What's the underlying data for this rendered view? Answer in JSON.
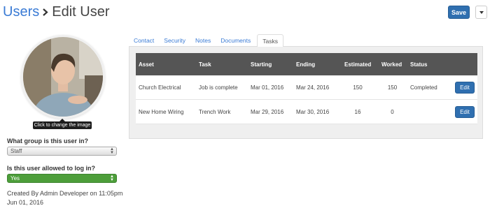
{
  "header": {
    "breadcrumb_root": "Users",
    "page_title": "Edit User",
    "save_label": "Save"
  },
  "profile": {
    "image_tooltip": "Click to change the image",
    "group_question": "What group is this user in?",
    "group_value": "Staff",
    "login_question": "Is this user allowed to log in?",
    "login_value": "Yes",
    "created_line1": "Created By Admin Developer on 11:05pm",
    "created_line2": "Jun 01, 2016"
  },
  "tabs": [
    {
      "label": "Contact"
    },
    {
      "label": "Security"
    },
    {
      "label": "Notes"
    },
    {
      "label": "Documents"
    },
    {
      "label": "Tasks",
      "active": true
    }
  ],
  "tasks_table": {
    "headers": {
      "asset": "Asset",
      "task": "Task",
      "starting": "Starting",
      "ending": "Ending",
      "estimated": "Estimated",
      "worked": "Worked",
      "status": "Status"
    },
    "rows": [
      {
        "asset": "Church Electrical",
        "task": "Job is complete",
        "starting": "Mar 01, 2016",
        "ending": "Mar 24, 2016",
        "estimated": "150",
        "worked": "150",
        "status": "Completed",
        "action": "Edit"
      },
      {
        "asset": "New Home Wiring",
        "task": "Trench Work",
        "starting": "Mar 29, 2016",
        "ending": "Mar 30, 2016",
        "estimated": "16",
        "worked": "0",
        "status": "",
        "action": "Edit"
      }
    ]
  },
  "colors": {
    "link": "#3a7bd5",
    "primary_button": "#2f6fb0",
    "table_header": "#555555",
    "login_select": "#4d9e3a"
  },
  "icons": {
    "breadcrumb_separator": "chevron-right-icon",
    "dropdown": "caret-down-icon",
    "select_arrows": "select-arrows-icon"
  }
}
